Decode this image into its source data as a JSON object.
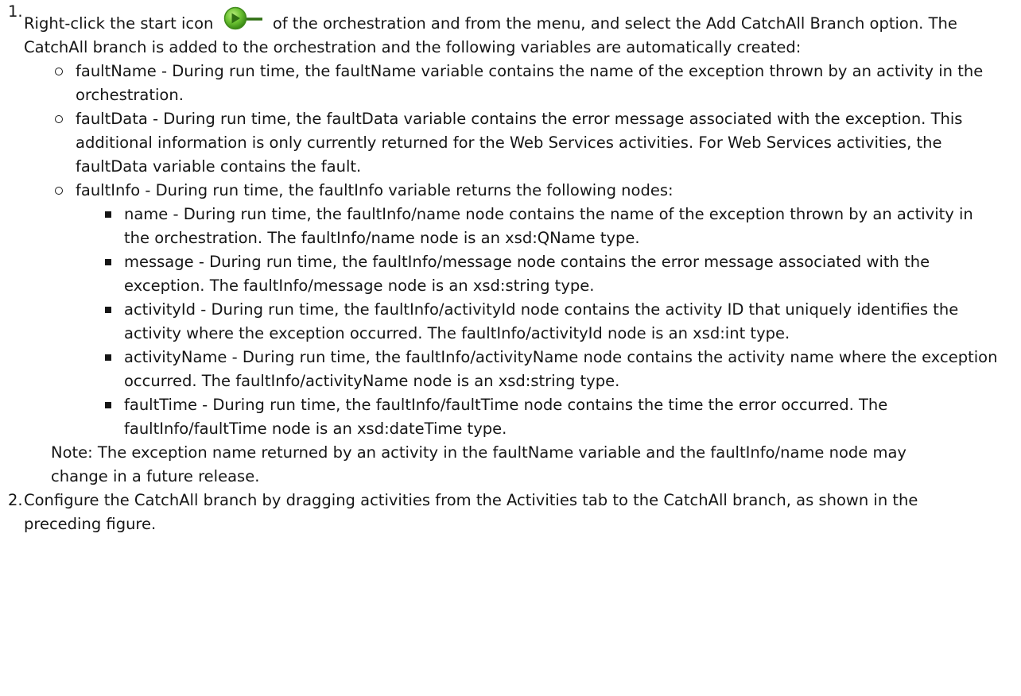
{
  "steps": [
    {
      "number": "1.",
      "text_before_icon": "Right-click the start icon",
      "icon": "orchestration-start-icon",
      "text_after_icon": "of the orchestration and from the menu, and select the Add CatchAll Branch option. The CatchAll branch is added to the orchestration and the following variables are automatically created:",
      "variables": [
        {
          "text": "faultName - During run time, the faultName variable contains the name of the exception thrown by an activity in the orchestration."
        },
        {
          "text": "faultData - During run time, the faultData variable contains the error message associated with the exception. This additional information is only currently returned for the Web Services activities. For Web Services activities, the faultData variable contains the fault."
        },
        {
          "text": "faultInfo - During run time, the faultInfo variable returns the following nodes:",
          "nodes": [
            "name - During run time, the faultInfo/name node contains the name of the exception thrown by an activity in the orchestration. The faultInfo/name node is an xsd:QName type.",
            "message - During run time, the faultInfo/message node contains the error message associated with the exception. The faultInfo/message node is an xsd:string type.",
            "activityId - During run time, the faultInfo/activityId node contains the activity ID that uniquely identifies the activity where the exception occurred. The faultInfo/activityId node is an xsd:int type.",
            "activityName - During run time, the faultInfo/activityName node contains the activity name where the exception occurred. The faultInfo/activityName node is an xsd:string type.",
            "faultTime - During run time, the faultInfo/faultTime node contains the time the error occurred. The faultInfo/faultTime node is an xsd:dateTime type."
          ]
        }
      ],
      "note": "Note: The exception name returned by an activity in the faultName variable and the faultInfo/name node may change in a future release."
    },
    {
      "number": "2.",
      "text": "Configure the CatchAll branch by dragging activities from the Activities tab to the CatchAll branch, as shown in the preceding figure."
    }
  ],
  "colors": {
    "text": "#161616",
    "icon_green": "#5cae2a",
    "icon_dark_green": "#2f6f12"
  }
}
